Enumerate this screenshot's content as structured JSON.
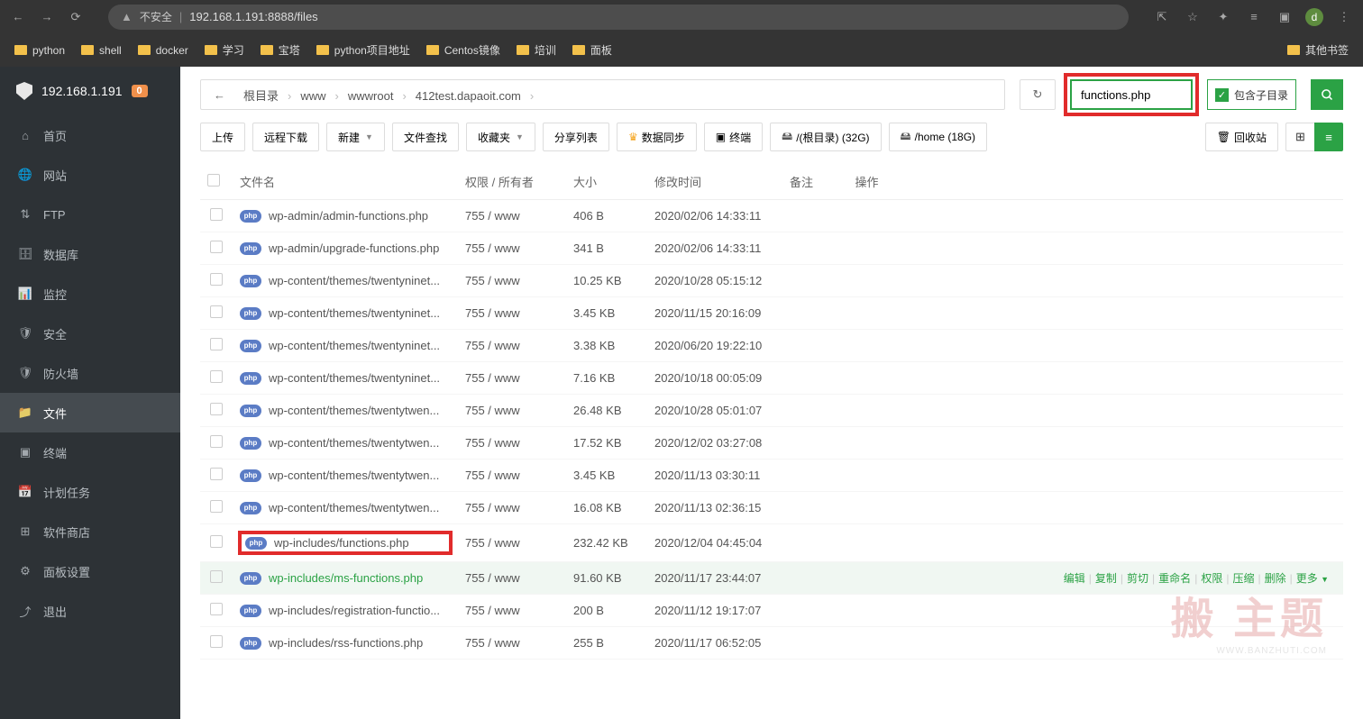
{
  "browser": {
    "insecure_label": "不安全",
    "url": "192.168.1.191:8888/files",
    "avatar_letter": "d"
  },
  "bookmarks": [
    "python",
    "shell",
    "docker",
    "学习",
    "宝塔",
    "python项目地址",
    "Centos镜像",
    "培训",
    "面板"
  ],
  "bookmarks_other": "其他书签",
  "sidebar": {
    "server_ip": "192.168.1.191",
    "notif_count": "0",
    "items": [
      {
        "icon": "home",
        "label": "首页"
      },
      {
        "icon": "globe",
        "label": "网站"
      },
      {
        "icon": "ftp",
        "label": "FTP"
      },
      {
        "icon": "db",
        "label": "数据库"
      },
      {
        "icon": "monitor",
        "label": "监控"
      },
      {
        "icon": "shield",
        "label": "安全"
      },
      {
        "icon": "firewall",
        "label": "防火墙"
      },
      {
        "icon": "folder",
        "label": "文件",
        "active": true
      },
      {
        "icon": "terminal",
        "label": "终端"
      },
      {
        "icon": "cron",
        "label": "计划任务"
      },
      {
        "icon": "store",
        "label": "软件商店"
      },
      {
        "icon": "settings",
        "label": "面板设置"
      },
      {
        "icon": "logout",
        "label": "退出"
      }
    ]
  },
  "breadcrumbs": [
    "根目录",
    "www",
    "wwwroot",
    "412test.dapaoit.com"
  ],
  "search": {
    "value": "functions.php",
    "subdir_label": "包含子目录"
  },
  "toolbar": {
    "upload": "上传",
    "remote": "远程下载",
    "new": "新建",
    "find": "文件查找",
    "fav": "收藏夹",
    "share": "分享列表",
    "sync": "数据同步",
    "terminal": "终端",
    "disk_root": "/(根目录) (32G)",
    "disk_home": "/home (18G)",
    "recycle": "回收站"
  },
  "table": {
    "headers": {
      "name": "文件名",
      "perm": "权限 / 所有者",
      "size": "大小",
      "date": "修改时间",
      "note": "备注",
      "action": "操作"
    },
    "rows": [
      {
        "name": "wp-admin/admin-functions.php",
        "perm": "755 / www",
        "size": "406 B",
        "date": "2020/02/06 14:33:11"
      },
      {
        "name": "wp-admin/upgrade-functions.php",
        "perm": "755 / www",
        "size": "341 B",
        "date": "2020/02/06 14:33:11"
      },
      {
        "name": "wp-content/themes/twentyninet...",
        "perm": "755 / www",
        "size": "10.25 KB",
        "date": "2020/10/28 05:15:12"
      },
      {
        "name": "wp-content/themes/twentyninet...",
        "perm": "755 / www",
        "size": "3.45 KB",
        "date": "2020/11/15 20:16:09"
      },
      {
        "name": "wp-content/themes/twentyninet...",
        "perm": "755 / www",
        "size": "3.38 KB",
        "date": "2020/06/20 19:22:10"
      },
      {
        "name": "wp-content/themes/twentyninet...",
        "perm": "755 / www",
        "size": "7.16 KB",
        "date": "2020/10/18 00:05:09"
      },
      {
        "name": "wp-content/themes/twentytwen...",
        "perm": "755 / www",
        "size": "26.48 KB",
        "date": "2020/10/28 05:01:07"
      },
      {
        "name": "wp-content/themes/twentytwen...",
        "perm": "755 / www",
        "size": "17.52 KB",
        "date": "2020/12/02 03:27:08"
      },
      {
        "name": "wp-content/themes/twentytwen...",
        "perm": "755 / www",
        "size": "3.45 KB",
        "date": "2020/11/13 03:30:11"
      },
      {
        "name": "wp-content/themes/twentytwen...",
        "perm": "755 / www",
        "size": "16.08 KB",
        "date": "2020/11/13 02:36:15"
      },
      {
        "name": "wp-includes/functions.php",
        "perm": "755 / www",
        "size": "232.42 KB",
        "date": "2020/12/04 04:45:04",
        "highlight": true
      },
      {
        "name": "wp-includes/ms-functions.php",
        "perm": "755 / www",
        "size": "91.60 KB",
        "date": "2020/11/17 23:44:07",
        "hovered": true
      },
      {
        "name": "wp-includes/registration-functio...",
        "perm": "755 / www",
        "size": "200 B",
        "date": "2020/11/12 19:17:07"
      },
      {
        "name": "wp-includes/rss-functions.php",
        "perm": "755 / www",
        "size": "255 B",
        "date": "2020/11/17 06:52:05"
      }
    ]
  },
  "row_actions": [
    "编辑",
    "复制",
    "剪切",
    "重命名",
    "权限",
    "压缩",
    "删除",
    "更多"
  ],
  "watermark": {
    "big": "搬 主题",
    "sub": "WWW.BANZHUTI.COM"
  }
}
